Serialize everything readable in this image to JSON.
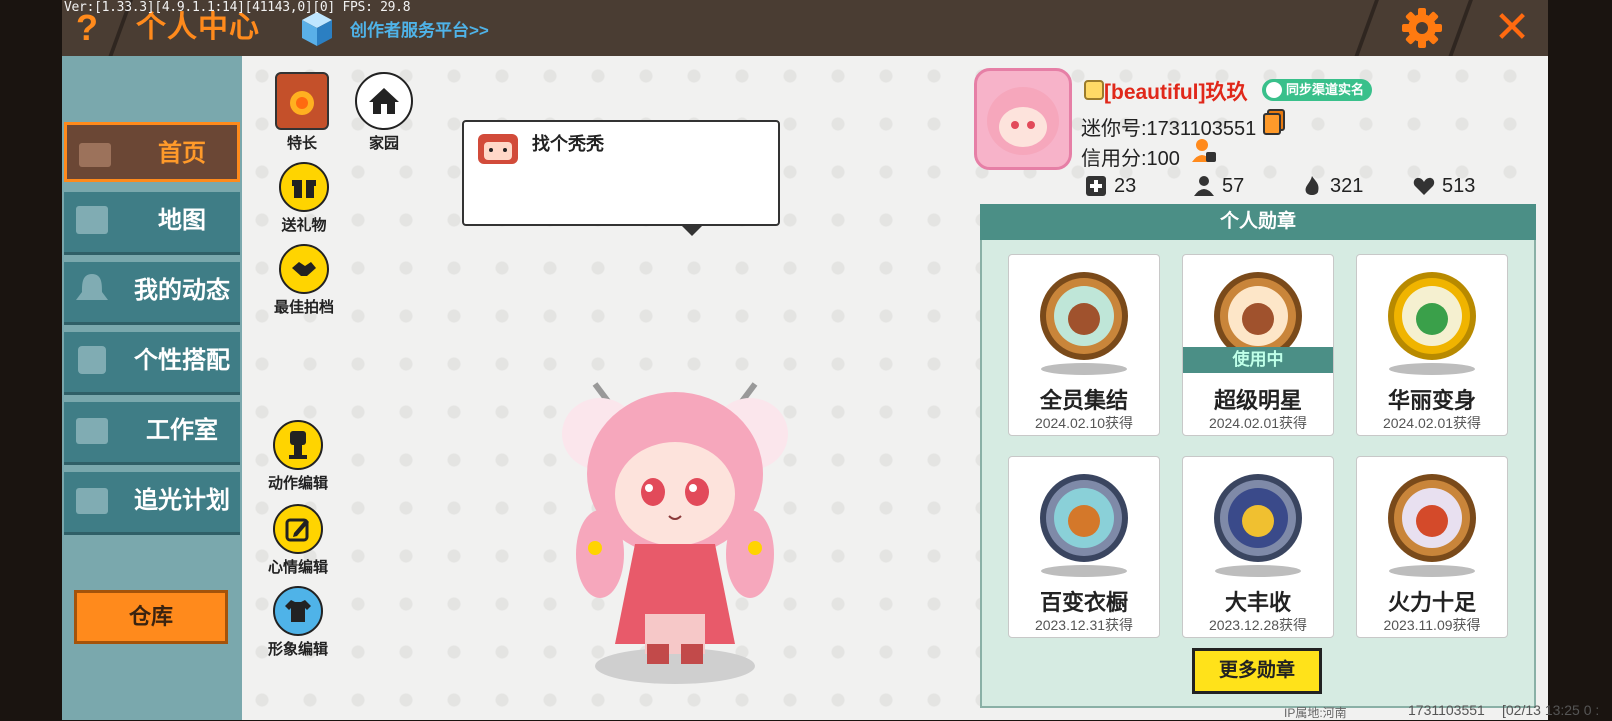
{
  "debug": "Ver:[1.33.3][4.9.1.1:14][41143,0][0] FPS: 29.8",
  "header": {
    "help_label": "?",
    "title": "个人中心",
    "creator_link": "创作者服务平台>>",
    "close_label": "✕"
  },
  "nav": {
    "items": [
      {
        "label": "首页",
        "active": true
      },
      {
        "label": "地图"
      },
      {
        "label": "我的动态"
      },
      {
        "label": "个性搭配"
      },
      {
        "label": "工作室"
      },
      {
        "label": "追光计划"
      }
    ],
    "warehouse": "仓库"
  },
  "actions": {
    "skill": "特长",
    "home": "家园",
    "gift": "送礼物",
    "partner": "最佳拍档",
    "motion": "动作编辑",
    "mood": "心情编辑",
    "look": "形象编辑"
  },
  "speech": {
    "text": "找个秃秃"
  },
  "profile": {
    "nickname": "[beautiful]玖玖",
    "realname_badge": "同步渠道实名",
    "mini_id": "迷你号:1731103551",
    "credit": "信用分:100",
    "stats": {
      "friends": "23",
      "fans": "57",
      "heat": "321",
      "likes": "513"
    }
  },
  "badges": {
    "header": "个人勋章",
    "in_use_label": "使用中",
    "items": [
      {
        "name": "全员集结",
        "date": "2024.02.10获得",
        "color": "#c9853a"
      },
      {
        "name": "超级明星",
        "date": "2024.02.01获得",
        "color": "#c9853a",
        "in_use": true
      },
      {
        "name": "华丽变身",
        "date": "2024.02.01获得",
        "color": "#f0b400"
      },
      {
        "name": "百变衣橱",
        "date": "2023.12.31获得",
        "color": "#7f8aa8"
      },
      {
        "name": "大丰收",
        "date": "2023.12.28获得",
        "color": "#7f8aa8"
      },
      {
        "name": "火力十足",
        "date": "2023.11.09获得",
        "color": "#c9853a"
      }
    ],
    "more": "更多勋章"
  },
  "footer": {
    "ip_location": "IP属地:河南",
    "uid": "1731103551",
    "time": "[02/13 13:25 0 :"
  }
}
